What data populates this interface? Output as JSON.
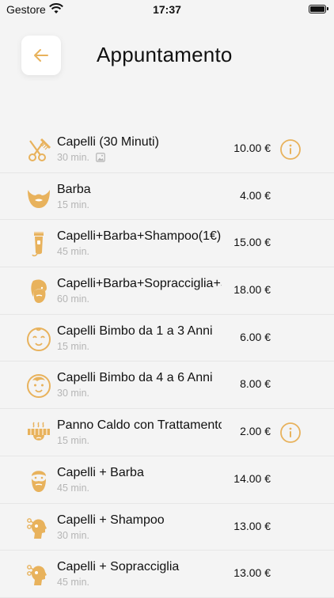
{
  "status_bar": {
    "carrier": "Gestore",
    "time": "17:37"
  },
  "header": {
    "title": "Appuntamento",
    "back_icon": "arrow-left-icon"
  },
  "colors": {
    "accent": "#e8b25c",
    "background": "#f4f4f4",
    "muted": "#b5b5b5",
    "divider": "#e6e6e6"
  },
  "services": [
    {
      "name": "Capelli (30 Minuti)",
      "duration": "30 min.",
      "price": "10.00 €",
      "icon": "scissors-comb-icon",
      "has_photo": true,
      "has_info": true
    },
    {
      "name": "Barba",
      "duration": "15 min.",
      "price": "4.00 €",
      "icon": "beard-icon",
      "has_photo": false,
      "has_info": false
    },
    {
      "name": "Capelli+Barba+Shampoo(1€)",
      "duration": "45 min.",
      "price": "15.00 €",
      "icon": "trimmer-icon",
      "has_photo": false,
      "has_info": false
    },
    {
      "name": "Capelli+Barba+Sopracciglia+S",
      "duration": "60 min.",
      "price": "18.00 €",
      "icon": "bearded-face-icon",
      "has_photo": false,
      "has_info": false
    },
    {
      "name": "Capelli Bimbo da 1 a 3 Anni",
      "duration": "15 min.",
      "price": "6.00 €",
      "icon": "baby-face-icon",
      "has_photo": false,
      "has_info": false
    },
    {
      "name": "Capelli Bimbo da 4 a 6 Anni",
      "duration": "30 min.",
      "price": "8.00 €",
      "icon": "child-face-icon",
      "has_photo": false,
      "has_info": false
    },
    {
      "name": "Panno Caldo con Trattamento",
      "duration": "15 min.",
      "price": "2.00 €",
      "icon": "hot-towel-icon",
      "has_photo": false,
      "has_info": true
    },
    {
      "name": "Capelli + Barba",
      "duration": "45 min.",
      "price": "14.00 €",
      "icon": "man-beard-icon",
      "has_photo": false,
      "has_info": false
    },
    {
      "name": "Capelli + Shampoo",
      "duration": "30 min.",
      "price": "13.00 €",
      "icon": "head-scissors-icon",
      "has_photo": false,
      "has_info": false
    },
    {
      "name": "Capelli + Sopracciglia",
      "duration": "45 min.",
      "price": "13.00 €",
      "icon": "head-scissors-icon",
      "has_photo": false,
      "has_info": false
    }
  ]
}
